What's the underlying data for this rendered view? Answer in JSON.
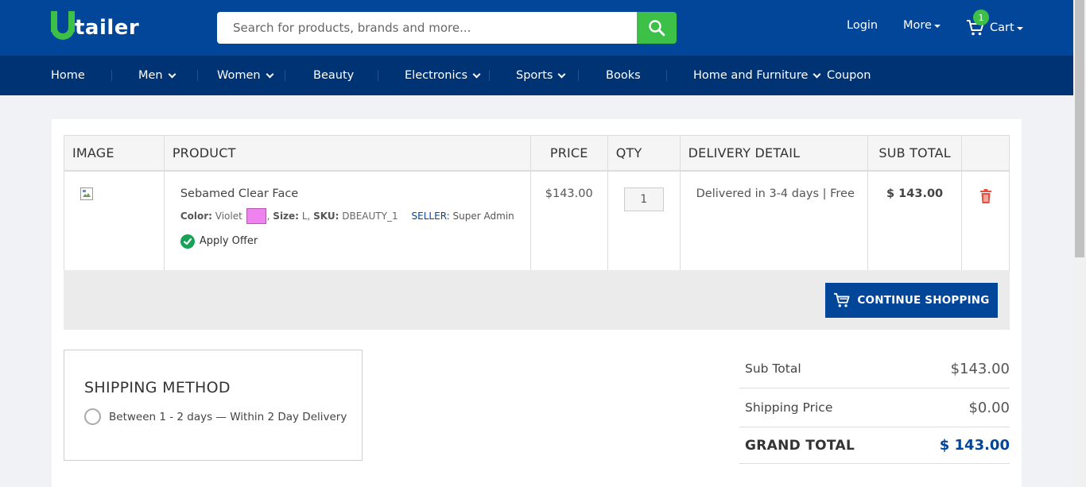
{
  "header": {
    "logo_text": "tailer",
    "search_placeholder": "Search for products, brands and more...",
    "login": "Login",
    "more": "More",
    "cart_label": "Cart",
    "cart_count": "1"
  },
  "nav": {
    "items": [
      "Home",
      "Men",
      "Women",
      "Beauty",
      "Electronics",
      "Sports",
      "Books",
      "Home and Furniture",
      "Coupon"
    ]
  },
  "cart_table": {
    "headers": {
      "image": "IMAGE",
      "product": "PRODUCT",
      "price": "PRICE",
      "qty": "QTY",
      "delivery": "DELIVERY DETAIL",
      "subtotal": "SUB TOTAL"
    },
    "rows": [
      {
        "name": "Sebamed Clear Face",
        "color_label": "Color:",
        "color_value": "Violet",
        "swatch_color": "#ee82ee",
        "size_label": "Size:",
        "size_value": "L",
        "sku_label": "SKU:",
        "sku_value": "DBEAUTY_1",
        "seller_label": "SELLER:",
        "seller_value": "Super Admin",
        "offer": "Apply Offer",
        "price": "$143.00",
        "qty": "1",
        "delivery": "Delivered in 3-4 days | Free",
        "subtotal": "$ 143.00"
      }
    ]
  },
  "continue_shopping": "CONTINUE SHOPPING",
  "shipping": {
    "title": "SHIPPING METHOD",
    "option": "Between 1 - 2 days — Within 2 Day Delivery"
  },
  "totals": {
    "subtotal_label": "Sub Total",
    "subtotal_value": "$143.00",
    "shipping_label": "Shipping Price",
    "shipping_value": "$0.00",
    "grand_label": "GRAND TOTAL",
    "grand_value": "$ 143.00"
  },
  "colors": {
    "brand_blue": "#02469a",
    "nav_blue": "#003374",
    "brand_green": "#3dc047",
    "delete_red": "#e74c3c"
  }
}
